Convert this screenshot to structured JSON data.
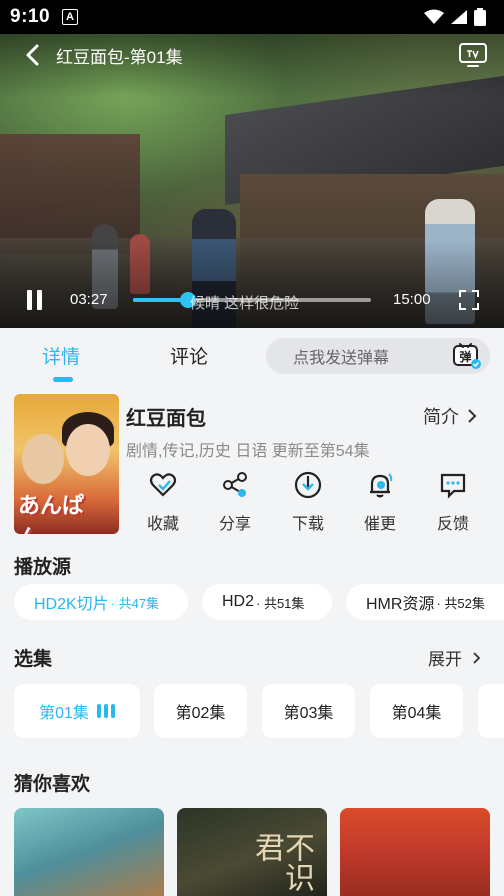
{
  "status_bar": {
    "time": "9:10",
    "notif_icon_text": "A"
  },
  "player": {
    "title": "红豆面包-第01集",
    "current_time": "03:27",
    "total_time": "15:00",
    "subtitle": "候晴 这样很危险",
    "progress_fraction": 0.23
  },
  "tabs": [
    {
      "label": "详情",
      "active": true
    },
    {
      "label": "评论",
      "active": false
    }
  ],
  "danmaku": {
    "placeholder": "点我发送弹幕",
    "icon_text": "弹"
  },
  "show": {
    "title": "红豆面包",
    "intro_label": "简介",
    "meta": "剧情,传记,历史 日语 更新至第54集",
    "poster_logo": "あんぱん"
  },
  "actions": [
    {
      "label": "收藏",
      "icon": "heart-icon"
    },
    {
      "label": "分享",
      "icon": "share-icon"
    },
    {
      "label": "下载",
      "icon": "download-icon"
    },
    {
      "label": "催更",
      "icon": "bell-icon"
    },
    {
      "label": "反馈",
      "icon": "feedback-icon"
    }
  ],
  "sources": {
    "title": "播放源",
    "items": [
      {
        "name": "HD2K切片",
        "count": " · 共47集",
        "active": true
      },
      {
        "name": "HD2",
        "count": " · 共51集",
        "active": false
      },
      {
        "name": "HMR资源",
        "count": " · 共52集",
        "active": false
      }
    ]
  },
  "episodes": {
    "title": "选集",
    "expand_label": "展开",
    "items": [
      {
        "label": "第01集",
        "active": true
      },
      {
        "label": "第02集",
        "active": false
      },
      {
        "label": "第03集",
        "active": false
      },
      {
        "label": "第04集",
        "active": false
      }
    ]
  },
  "recommend": {
    "title": "猜你喜欢",
    "r2_text": "不识君"
  },
  "colors": {
    "accent": "#27b9ef",
    "background": "#f3f4f6"
  }
}
